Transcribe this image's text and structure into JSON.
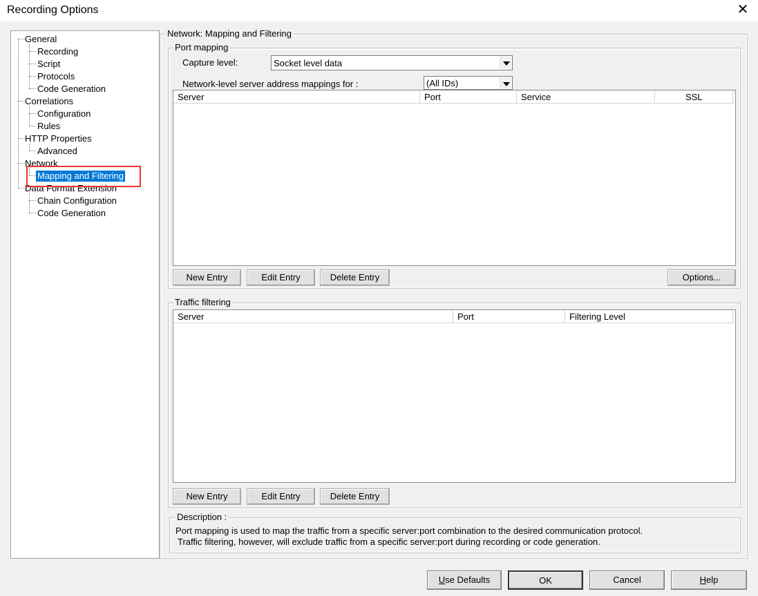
{
  "window": {
    "title": "Recording Options",
    "close_symbol": "✕"
  },
  "tree": {
    "items": [
      {
        "label": "General"
      },
      {
        "label": "Recording"
      },
      {
        "label": "Script"
      },
      {
        "label": "Protocols"
      },
      {
        "label": "Code Generation"
      },
      {
        "label": "Correlations"
      },
      {
        "label": "Configuration"
      },
      {
        "label": "Rules"
      },
      {
        "label": "HTTP Properties"
      },
      {
        "label": "Advanced"
      },
      {
        "label": "Network"
      },
      {
        "label": "Mapping and Filtering"
      },
      {
        "label": "Data Format Extension"
      },
      {
        "label": "Chain Configuration"
      },
      {
        "label": "Code Generation"
      }
    ],
    "selected_label": "Mapping and Filtering"
  },
  "main": {
    "group_title": "Network: Mapping and Filtering",
    "port_mapping": {
      "title": "Port mapping",
      "capture_level_label": "Capture level:",
      "capture_level_value": "Socket level data",
      "mappings_for_label": "Network-level server address mappings for :",
      "mappings_for_value": "(All IDs)",
      "columns": [
        "Server",
        "Port",
        "Service",
        "SSL"
      ],
      "buttons": {
        "new": "New Entry",
        "edit": "Edit Entry",
        "delete": "Delete Entry",
        "options": "Options..."
      }
    },
    "traffic_filtering": {
      "title": "Traffic filtering",
      "columns": [
        "Server",
        "Port",
        "Filtering Level"
      ],
      "buttons": {
        "new": "New Entry",
        "edit": "Edit Entry",
        "delete": "Delete Entry"
      }
    },
    "description": {
      "title": "Description :",
      "line1": "Port mapping is used to map the traffic from a specific server:port combination to the desired communication protocol.",
      "line2": "Traffic filtering, however, will exclude traffic from a specific server:port during recording or code generation."
    }
  },
  "footer": {
    "use_defaults_prefix": "U",
    "use_defaults_rest": "se Defaults",
    "ok": "OK",
    "cancel": "Cancel",
    "help_prefix": "H",
    "help_rest": "elp"
  },
  "colors": {
    "selection": "#0078d7",
    "highlight_box": "#e8362d"
  }
}
